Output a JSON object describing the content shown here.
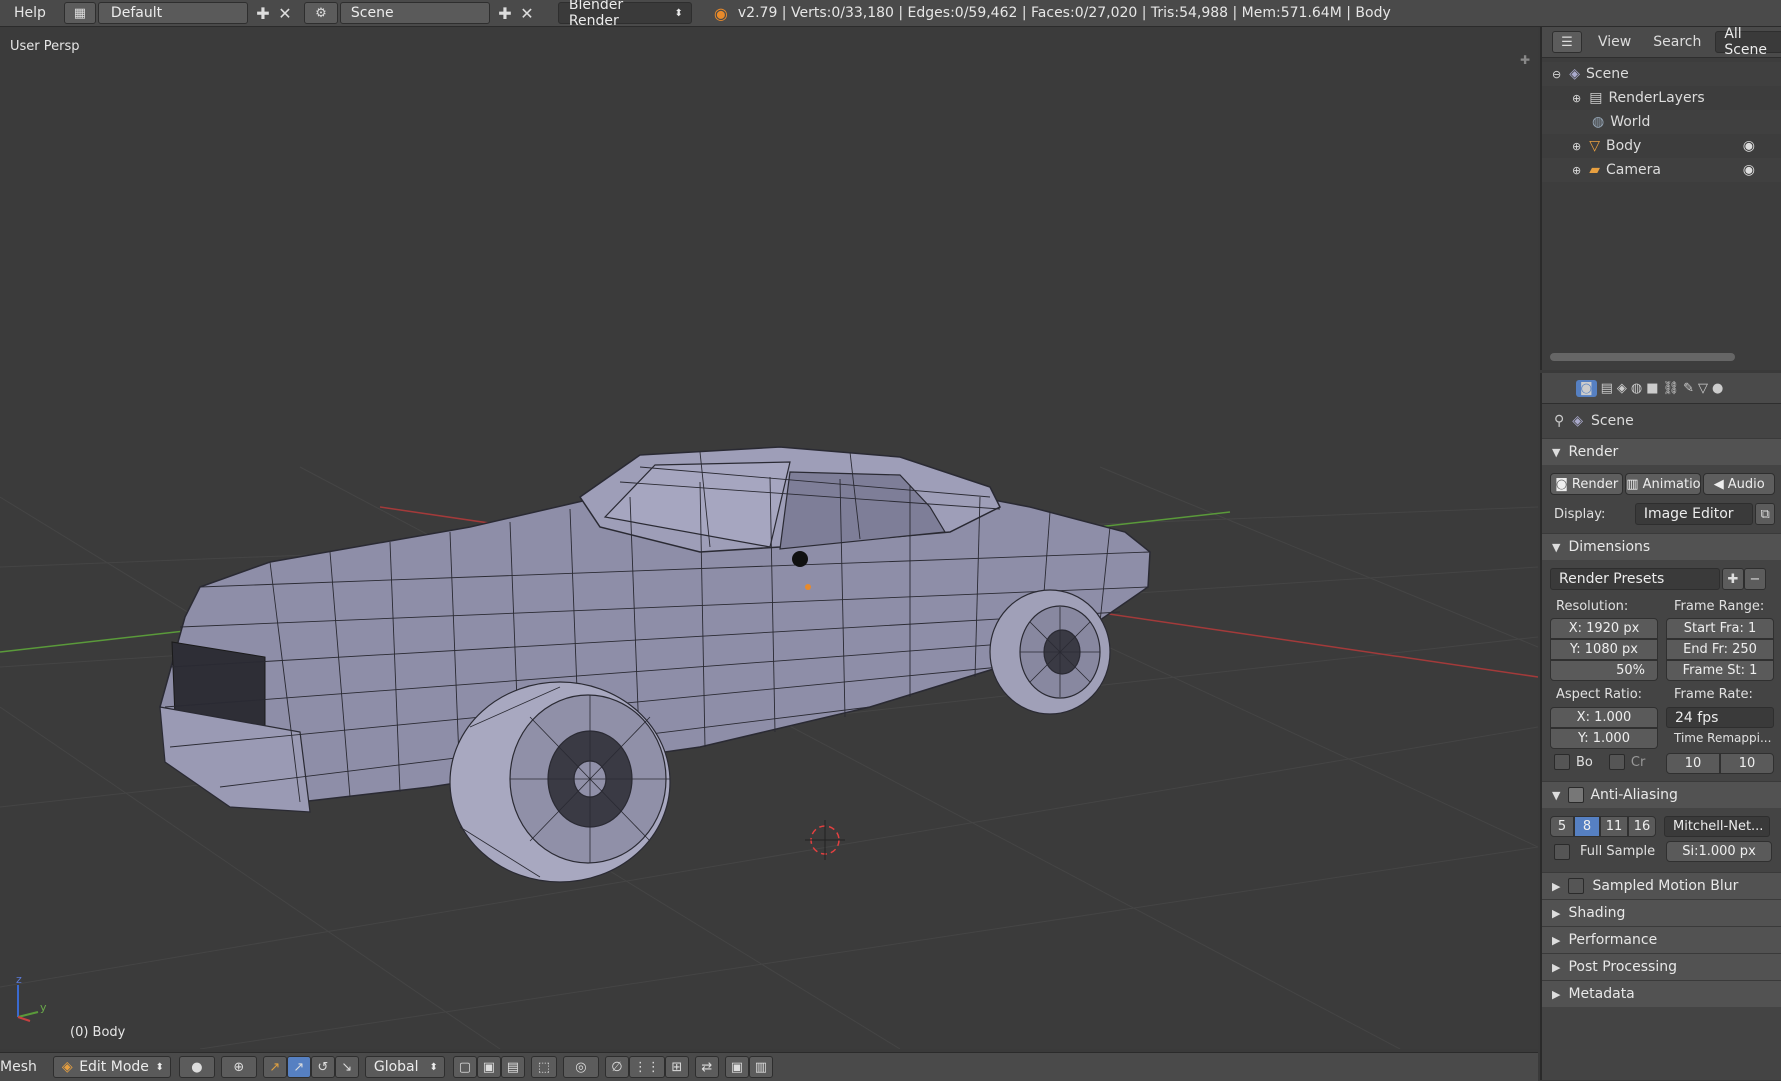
{
  "topbar": {
    "help": "Help",
    "layout": "Default",
    "scene": "Scene",
    "engine": "Blender Render",
    "stats": "v2.79 | Verts:0/33,180 | Edges:0/59,462 | Faces:0/27,020 | Tris:54,988 | Mem:571.64M | Body"
  },
  "viewport": {
    "view_label": "User Persp",
    "object_label": "(0) Body",
    "axis_z": "z",
    "axis_y": "y"
  },
  "bottombar": {
    "menu": "Mesh",
    "mode": "Edit Mode",
    "orientation": "Global"
  },
  "outliner": {
    "view": "View",
    "search": "Search",
    "filter": "All Scene",
    "items": [
      {
        "label": "Scene"
      },
      {
        "label": "RenderLayers"
      },
      {
        "label": "World"
      },
      {
        "label": "Body"
      },
      {
        "label": "Camera"
      }
    ]
  },
  "properties": {
    "context": "Scene",
    "render_panel": "Render",
    "render_btn": "Render",
    "animation_btn": "Animatio",
    "audio_btn": "Audio",
    "display_label": "Display:",
    "display_value": "Image Editor",
    "dimensions_panel": "Dimensions",
    "render_presets": "Render Presets",
    "resolution_label": "Resolution:",
    "res_x": "X: 1920 px",
    "res_y": "Y: 1080 px",
    "res_pct": "50%",
    "frame_range_label": "Frame Range:",
    "start_frame": "Start Fra: 1",
    "end_frame": "End Fr: 250",
    "frame_step": "Frame St: 1",
    "aspect_label": "Aspect Ratio:",
    "aspect_x": "X:  1.000",
    "aspect_y": "Y:  1.000",
    "frame_rate_label": "Frame Rate:",
    "frame_rate": "24 fps",
    "time_remap_label": "Time Remappi...",
    "remap_old": "10",
    "remap_new": "10",
    "border_label": "Bo",
    "crop_label": "Cr",
    "aa_panel": "Anti-Aliasing",
    "aa_samples": [
      "5",
      "8",
      "11",
      "16"
    ],
    "aa_filter": "Mitchell-Net...",
    "full_sample": "Full Sample",
    "filter_size": "Si:1.000 px",
    "motion_blur_panel": "Sampled Motion Blur",
    "shading_panel": "Shading",
    "performance_panel": "Performance",
    "post_processing_panel": "Post Processing",
    "metadata_panel": "Metadata"
  },
  "colors": {
    "accent": "#5680c2",
    "mesh": "#9a9ab4",
    "x_axis": "#a33a3a",
    "y_axis": "#5a9a3a"
  }
}
